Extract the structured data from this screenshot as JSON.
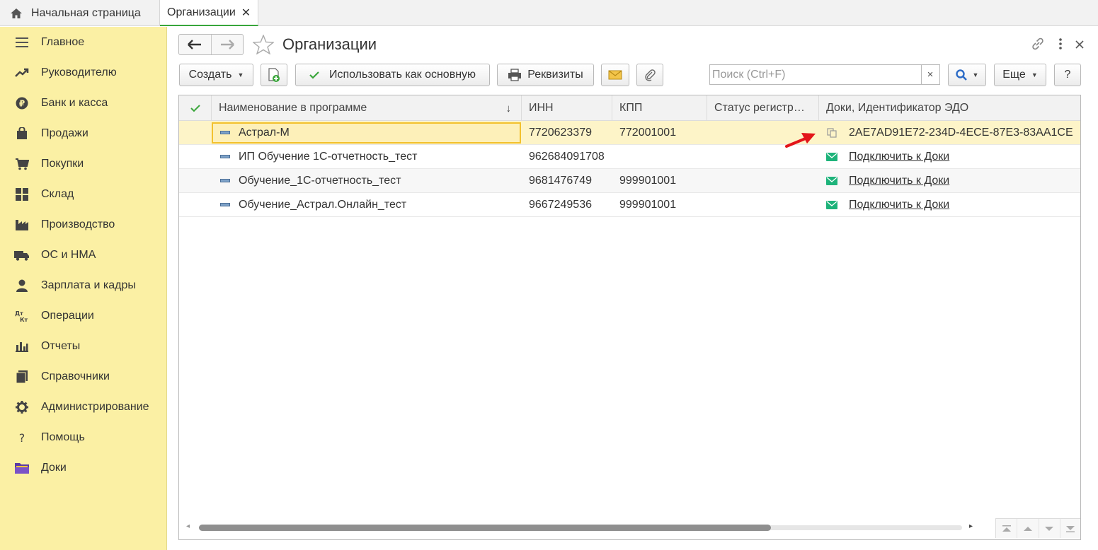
{
  "tabs": {
    "home_label": "Начальная страница",
    "active_label": "Организации",
    "close_symbol": "✕"
  },
  "sidebar": {
    "items": [
      {
        "label": "Главное",
        "icon": "menu-lines-icon"
      },
      {
        "label": "Руководителю",
        "icon": "trend-icon"
      },
      {
        "label": "Банк и касса",
        "icon": "ruble-icon"
      },
      {
        "label": "Продажи",
        "icon": "shopping-bag-icon"
      },
      {
        "label": "Покупки",
        "icon": "cart-icon"
      },
      {
        "label": "Склад",
        "icon": "warehouse-grid-icon"
      },
      {
        "label": "Производство",
        "icon": "factory-icon"
      },
      {
        "label": "ОС и НМА",
        "icon": "truck-icon"
      },
      {
        "label": "Зарплата и кадры",
        "icon": "person-icon"
      },
      {
        "label": "Операции",
        "icon": "dt-kt-icon"
      },
      {
        "label": "Отчеты",
        "icon": "bar-chart-icon"
      },
      {
        "label": "Справочники",
        "icon": "books-icon"
      },
      {
        "label": "Администрирование",
        "icon": "gear-icon"
      },
      {
        "label": "Помощь",
        "icon": "question-icon"
      },
      {
        "label": "Доки",
        "icon": "folder-icon"
      }
    ]
  },
  "header": {
    "title": "Организации"
  },
  "toolbar": {
    "create_label": "Создать",
    "use_main_label": "Использовать как основную",
    "requisites_label": "Реквизиты",
    "search_placeholder": "Поиск (Ctrl+F)",
    "clear_symbol": "×",
    "more_label": "Еще",
    "help_label": "?"
  },
  "table": {
    "columns": {
      "name": "Наименование в программе",
      "sort_symbol": "↓",
      "inn": "ИНН",
      "kpp": "КПП",
      "status": "Статус регистр…",
      "doki": "Доки, Идентификатор ЭДО"
    },
    "rows": [
      {
        "name": "Астрал-М",
        "inn": "7720623379",
        "kpp": "772001001",
        "status": "",
        "doki": "2AE7AD91E72-234D-4ECE-87E3-83AA1CE",
        "doki_link": false
      },
      {
        "name": "ИП Обучение 1С-отчетность_тест",
        "inn": "962684091708",
        "kpp": "",
        "status": "",
        "doki": "Подключить к Доки",
        "doki_link": true
      },
      {
        "name": "Обучение_1С-отчетность_тест",
        "inn": "9681476749",
        "kpp": "999901001",
        "status": "",
        "doki": "Подключить к Доки",
        "doki_link": true
      },
      {
        "name": "Обучение_Астрал.Онлайн_тест",
        "inn": "9667249536",
        "kpp": "999901001",
        "status": "",
        "doki": "Подключить к Доки",
        "doki_link": true
      }
    ]
  },
  "colors": {
    "sidebar_bg": "#fbf0a4",
    "active_tab_accent": "#38a63b",
    "selection_border": "#f2c12e",
    "annotation_arrow": "#e3151a",
    "edo_green": "#1db37a"
  }
}
